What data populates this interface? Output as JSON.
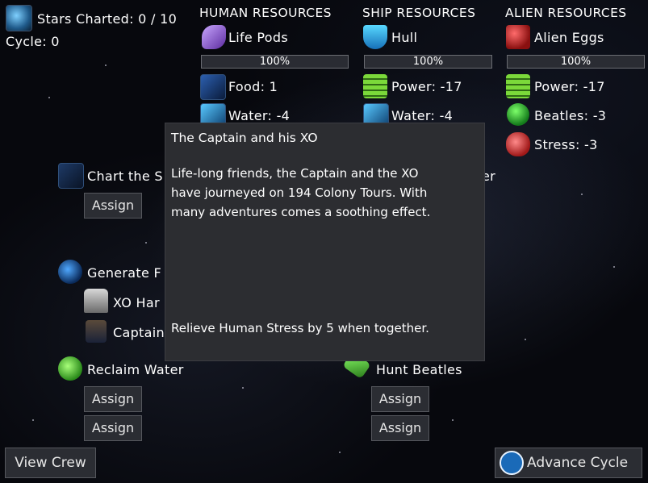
{
  "status": {
    "stars_charted": "Stars Charted: 0 / 10",
    "cycle": "Cycle: 0"
  },
  "human": {
    "header": "HUMAN RESOURCES",
    "life_pods": "Life Pods",
    "life_pods_pct": "100%",
    "food": "Food: 1",
    "water": "Water: -4"
  },
  "ship": {
    "header": "SHIP RESOURCES",
    "hull": "Hull",
    "hull_pct": "100%",
    "power": "Power: -17",
    "water": "Water: -4"
  },
  "alien": {
    "header": "ALIEN RESOURCES",
    "eggs": "Alien Eggs",
    "eggs_pct": "100%",
    "power": "Power: -17",
    "beatles": "Beatles: -3",
    "stress": "Stress: -3"
  },
  "tasks": {
    "chart": "Chart the S",
    "chart_right": "er",
    "generate": "Generate F",
    "crew_xo": "XO Har",
    "crew_captain": "Captain",
    "reclaim": "Reclaim Water",
    "hunt": "Hunt Beatles",
    "assign": "Assign"
  },
  "tooltip": {
    "title": "The Captain and his XO",
    "body": "Life-long friends, the Captain and the XO\nhave journeyed on 194 Colony Tours. With\nmany adventures comes a soothing effect.",
    "effect": "Relieve Human Stress by 5 when together."
  },
  "buttons": {
    "view_crew": "View Crew",
    "advance": "Advance Cycle"
  },
  "colors": {
    "background": "#07080d",
    "tooltip_bg": "#2c2d31",
    "button_bg": "#2b2d33",
    "bar_bg": "#2a2c33"
  }
}
